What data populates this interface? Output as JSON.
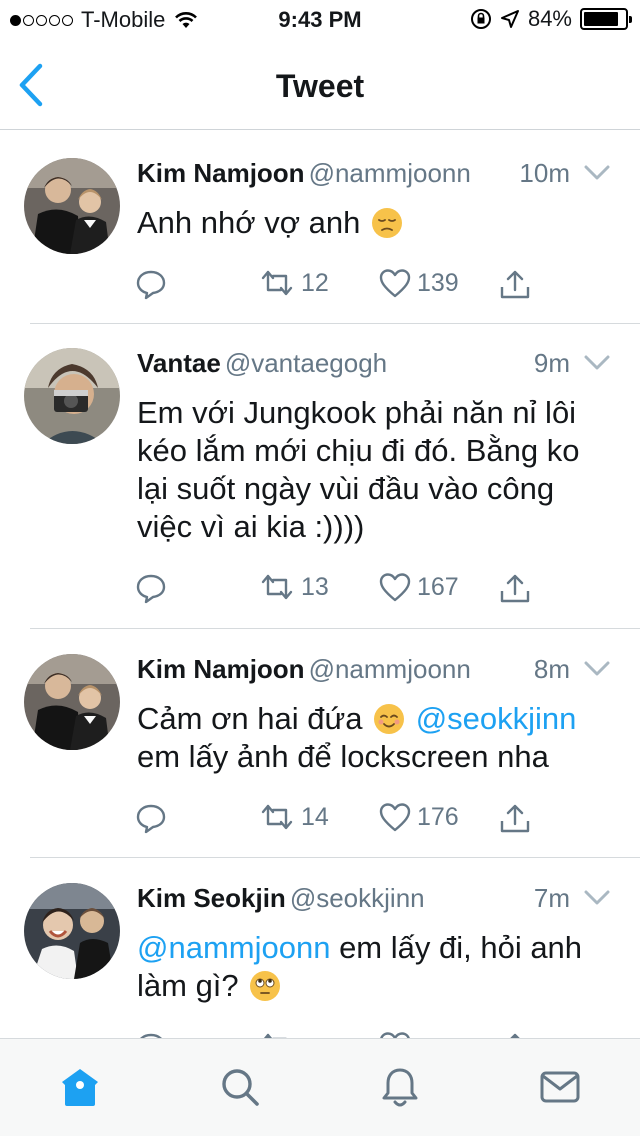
{
  "status_bar": {
    "carrier": "T-Mobile",
    "time": "9:43 PM",
    "battery": "84%",
    "battery_level": 0.84,
    "signal_dots_filled": 1,
    "signal_dots_total": 5
  },
  "nav": {
    "title": "Tweet",
    "back_icon": "chevron-left-icon"
  },
  "colors": {
    "accent": "#1da1f2",
    "secondary_text": "#657786",
    "text": "#14171a"
  },
  "tweets": [
    {
      "name": "Kim Namjoon",
      "handle": "@nammjoonn",
      "age": "10m",
      "segments": [
        {
          "type": "text",
          "value": "Anh nhớ vợ anh "
        },
        {
          "type": "emoji",
          "name": "pensive-face"
        }
      ],
      "replies": "",
      "retweets": "12",
      "likes": "139"
    },
    {
      "name": "Vantae",
      "handle": "@vantaegogh",
      "age": "9m",
      "segments": [
        {
          "type": "text",
          "value": "Em với Jungkook phải năn nỉ lôi kéo lắm mới chịu đi đó. Bằng ko lại suốt ngày vùi đầu vào công việc vì ai kia :))))"
        }
      ],
      "replies": "",
      "retweets": "13",
      "likes": "167"
    },
    {
      "name": "Kim Namjoon",
      "handle": "@nammjoonn",
      "age": "8m",
      "segments": [
        {
          "type": "text",
          "value": "Cảm ơn hai đứa "
        },
        {
          "type": "emoji",
          "name": "smiling-face"
        },
        {
          "type": "text",
          "value": " "
        },
        {
          "type": "mention",
          "value": "@seokkjinn"
        },
        {
          "type": "text",
          "value": " em lấy ảnh để lockscreen nha"
        }
      ],
      "replies": "",
      "retweets": "14",
      "likes": "176"
    },
    {
      "name": "Kim Seokjin",
      "handle": "@seokkjinn",
      "age": "7m",
      "segments": [
        {
          "type": "mention",
          "value": "@nammjoonn"
        },
        {
          "type": "text",
          "value": " em lấy đi, hỏi anh làm gì? "
        },
        {
          "type": "emoji",
          "name": "rolling-eyes-face"
        }
      ],
      "replies": "",
      "retweets": "",
      "likes": ""
    }
  ],
  "tab_bar": {
    "items": [
      {
        "name": "home-icon",
        "active": true
      },
      {
        "name": "search-icon",
        "active": false
      },
      {
        "name": "notifications-icon",
        "active": false
      },
      {
        "name": "messages-icon",
        "active": false
      }
    ]
  }
}
